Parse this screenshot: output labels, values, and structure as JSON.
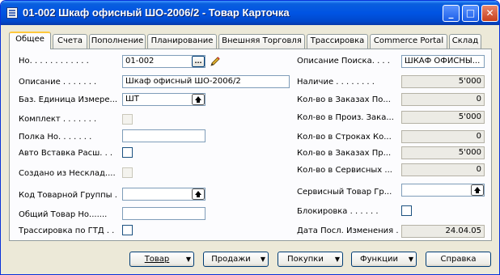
{
  "window": {
    "title": "01-002 Шкаф офисный ШО-2006/2 - Товар Карточка",
    "minimize": "_",
    "maximize": "□",
    "close": "✕"
  },
  "tabs": [
    "Общее",
    "Счета",
    "Пополнение",
    "Планирование",
    "Внешняя Торговля",
    "Трассировка",
    "Commerce Portal",
    "Склад"
  ],
  "left": {
    "no_label": "Но. . . . . . . . . . . .",
    "no_value": "01-002",
    "assist_button": "...",
    "description_label": "Описание . . . . . . .",
    "description_value": "Шкаф офисный ШО-2006/2",
    "base_unit_label": "Баз. Единица Измере...",
    "base_unit_value": "ШТ",
    "kit_label": "Комплект . . . . . . .",
    "shelf_label": "Полка Но. . . . . . .",
    "shelf_value": "",
    "auto_insert_label": "Авто Вставка Расш. . .",
    "created_from_label": "Создано из Несклад....",
    "item_group_label": "Код Товарной Группы .",
    "item_group_value": "",
    "common_item_label": "Общий Товар Но.......",
    "common_item_value": "",
    "gtd_label": "Трассировка по ГТД . ."
  },
  "right": {
    "search_desc_label": "Описание Поиска. . . .",
    "search_desc_value": "ШКАФ ОФИСНЫ...",
    "inventory_label": "Наличие . . . . . . . .",
    "inventory_value": "5'000",
    "purch_orders_label": "Кол-во в Заказах По...",
    "purch_orders_value": "0",
    "prod_orders_label": "Кол-во в Произ. Зака...",
    "prod_orders_value": "5'000",
    "comp_lines_label": "Кол-во в Строках Ко...",
    "comp_lines_value": "0",
    "sales_orders_label": "Кол-во в Заказах Пр...",
    "sales_orders_value": "5'000",
    "service_orders_label": "Кол-во в Сервисных ...",
    "service_orders_value": "0",
    "service_item_label": "Сервисный Товар Гр...",
    "service_item_value": "",
    "blocked_label": "Блокировка . . . . . .",
    "last_modified_label": "Дата Посл. Изменения .",
    "last_modified_value": "24.04.05"
  },
  "buttons": {
    "item": "Товар",
    "sales": "Продажи",
    "purchases": "Покупки",
    "functions": "Функции",
    "help": "Справка"
  },
  "icons": {
    "lookup": "up-arrow-lookup-icon",
    "pencil": "pencil-edit-icon",
    "dropdown": "triangle-down-icon"
  },
  "colors": {
    "titlebar": "#0054e3",
    "tab_highlight": "#ffc83c",
    "window_bg": "#ece9d8"
  }
}
